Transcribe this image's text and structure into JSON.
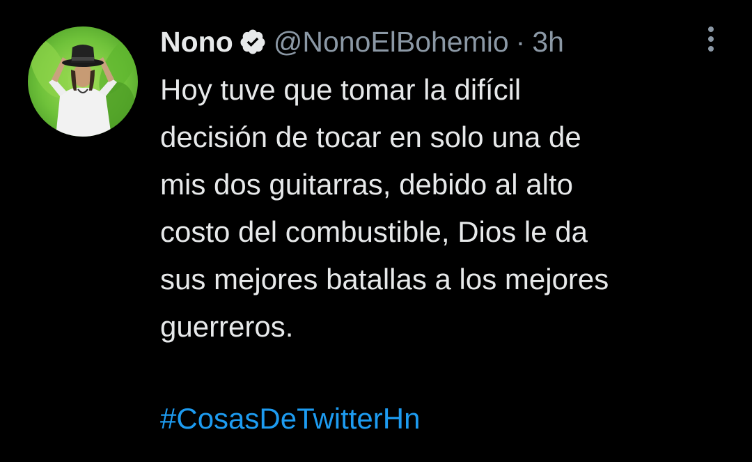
{
  "tweet": {
    "author": {
      "display_name": "Nono",
      "handle": "@NonoElBohemio",
      "verified": true
    },
    "separator": "·",
    "time": "3h",
    "text": "Hoy tuve que tomar la difícil\ndecisión de tocar en solo una de\nmis dos guitarras, debido al alto\ncosto del combustible, Dios le da\nsus mejores batallas a los mejores\nguerreros.",
    "hashtag": "#CosasDeTwitterHn"
  },
  "icons": {
    "verified": "verified-badge-icon",
    "more": "more-options-icon"
  },
  "colors": {
    "background": "#000000",
    "primary_text": "#e7e9ea",
    "secondary_text": "#8b98a5",
    "link": "#1d9bf0"
  }
}
